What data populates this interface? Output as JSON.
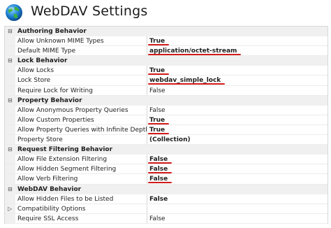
{
  "window": {
    "title": "WebDAV Settings",
    "icon": "globe-icon"
  },
  "colors": {
    "category_bg": "#f0f0f0",
    "grid_line": "#d8d8d8",
    "red_mark": "#d21b1b"
  },
  "categories": [
    {
      "name": "Authoring Behavior",
      "expanded": true,
      "properties": [
        {
          "name": "Allow Unknown MIME Types",
          "value": "True",
          "bold": true,
          "marked": true
        },
        {
          "name": "Default MIME Type",
          "value": "application/octet-stream",
          "bold": true,
          "marked": true
        }
      ]
    },
    {
      "name": "Lock Behavior",
      "expanded": true,
      "properties": [
        {
          "name": "Allow Locks",
          "value": "True",
          "bold": true,
          "marked": true
        },
        {
          "name": "Lock Store",
          "value": "webdav_simple_lock",
          "bold": true,
          "marked": true
        },
        {
          "name": "Require Lock for Writing",
          "value": "False",
          "bold": false,
          "marked": false
        }
      ]
    },
    {
      "name": "Property Behavior",
      "expanded": true,
      "properties": [
        {
          "name": "Allow Anonymous Property Queries",
          "value": "False",
          "bold": false,
          "marked": false
        },
        {
          "name": "Allow Custom Properties",
          "value": "True",
          "bold": true,
          "marked": true
        },
        {
          "name": "Allow Property Queries with Infinite Depth",
          "value": "True",
          "bold": true,
          "marked": true
        },
        {
          "name": "Property Store",
          "value": "(Collection)",
          "bold": true,
          "marked": false
        }
      ]
    },
    {
      "name": "Request Filtering Behavior",
      "expanded": true,
      "properties": [
        {
          "name": "Allow File Extension Filtering",
          "value": "False",
          "bold": true,
          "marked": true
        },
        {
          "name": "Allow Hidden Segment Filtering",
          "value": "False",
          "bold": true,
          "marked": true
        },
        {
          "name": "Allow Verb Filtering",
          "value": "False",
          "bold": true,
          "marked": true
        }
      ]
    },
    {
      "name": "WebDAV Behavior",
      "expanded": true,
      "properties": [
        {
          "name": "Allow Hidden Files to be Listed",
          "value": "False",
          "bold": true,
          "marked": false
        },
        {
          "name": "Compatibility Options",
          "value": "",
          "bold": false,
          "marked": false,
          "expandable": true
        },
        {
          "name": "Require SSL Access",
          "value": "False",
          "bold": false,
          "marked": false
        }
      ]
    }
  ]
}
